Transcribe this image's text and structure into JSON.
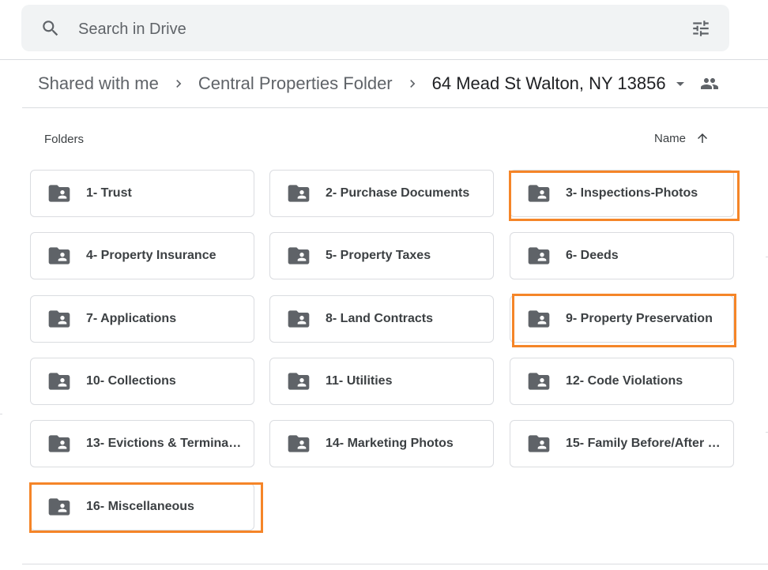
{
  "search": {
    "placeholder": "Search in Drive"
  },
  "breadcrumb": {
    "items": [
      {
        "label": "Shared with me"
      },
      {
        "label": "Central Properties Folder"
      },
      {
        "label": "64 Mead St Walton, NY 13856"
      }
    ]
  },
  "section": {
    "label": "Folders"
  },
  "sort": {
    "label": "Name",
    "direction": "ascending"
  },
  "folders": [
    {
      "name": "1- Trust",
      "highlighted": false
    },
    {
      "name": "2- Purchase Documents",
      "highlighted": false
    },
    {
      "name": "3- Inspections-Photos",
      "highlighted": true
    },
    {
      "name": "4- Property Insurance",
      "highlighted": false
    },
    {
      "name": "5- Property Taxes",
      "highlighted": false
    },
    {
      "name": "6- Deeds",
      "highlighted": false
    },
    {
      "name": "7- Applications",
      "highlighted": false
    },
    {
      "name": "8- Land Contracts",
      "highlighted": false
    },
    {
      "name": "9- Property Preservation",
      "highlighted": true
    },
    {
      "name": "10- Collections",
      "highlighted": false
    },
    {
      "name": "11- Utilities",
      "highlighted": false
    },
    {
      "name": "12- Code Violations",
      "highlighted": false
    },
    {
      "name": "13- Evictions & Terminati…",
      "highlighted": false
    },
    {
      "name": "14- Marketing Photos",
      "highlighted": false
    },
    {
      "name": "15- Family Before/After P…",
      "highlighted": false
    },
    {
      "name": "16- Miscellaneous",
      "highlighted": true
    }
  ],
  "colors": {
    "highlight": "#f58528",
    "icon": "#5f6368",
    "border": "#dadce0",
    "search_bg": "#f1f3f4"
  },
  "icons": {
    "search": "search-icon",
    "filter": "tune-icon",
    "separator": "chevron-right-icon",
    "dropdown": "arrow-drop-down-icon",
    "shared": "people-icon",
    "sort": "arrow-up-icon",
    "folder": "shared-folder-icon"
  }
}
